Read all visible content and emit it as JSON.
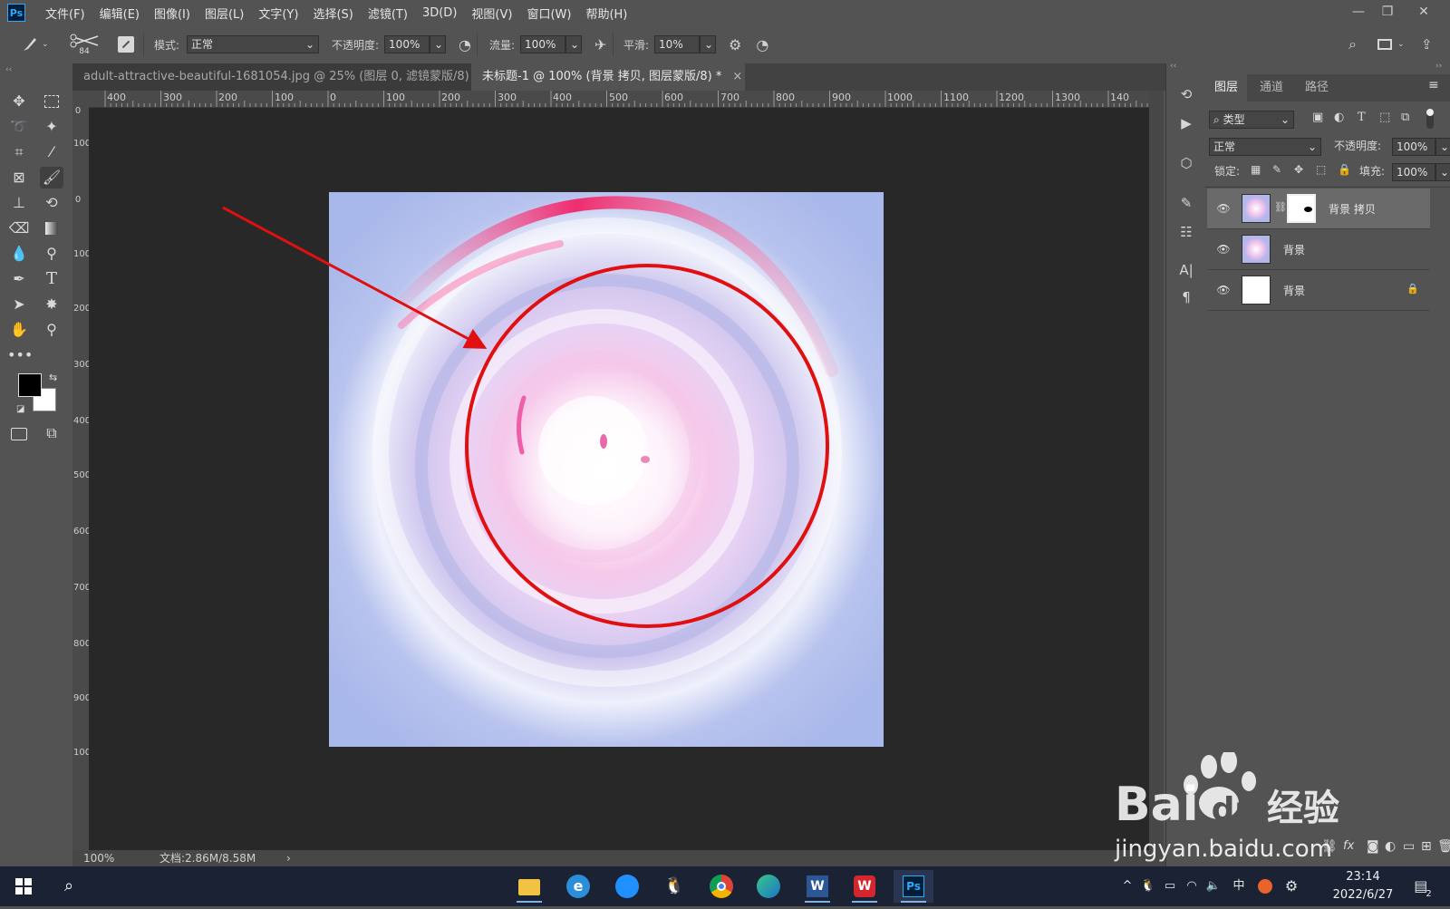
{
  "app": {
    "logo": "Ps"
  },
  "menu": [
    "文件(F)",
    "编辑(E)",
    "图像(I)",
    "图层(L)",
    "文字(Y)",
    "选择(S)",
    "滤镜(T)",
    "3D(D)",
    "视图(V)",
    "窗口(W)",
    "帮助(H)"
  ],
  "options": {
    "brush_size": "84",
    "mode_label": "模式:",
    "mode_value": "正常",
    "opacity_label": "不透明度:",
    "opacity_value": "100%",
    "flow_label": "流量:",
    "flow_value": "100%",
    "smoothing_label": "平滑:",
    "smoothing_value": "10%"
  },
  "tabs": [
    {
      "label": "adult-attractive-beautiful-1681054.jpg  @  25%  (图层 0, 滤镜蒙版/8) *",
      "close": "×"
    },
    {
      "label": "未标题-1 @ 100% (背景 拷贝, 图层蒙版/8) *",
      "close": "×"
    }
  ],
  "ruler_h": [
    "400",
    "300",
    "200",
    "100",
    "0",
    "100",
    "200",
    "300",
    "400",
    "500",
    "600",
    "700",
    "800",
    "900",
    "1000",
    "1100",
    "1200",
    "1300",
    "140"
  ],
  "ruler_v": [
    "0",
    "100",
    "0",
    "100",
    "200",
    "300",
    "400",
    "500",
    "600",
    "700",
    "800",
    "900",
    "100"
  ],
  "status": {
    "zoom": "100%",
    "doc": "文档:2.86M/8.58M",
    "arrow": "›"
  },
  "layers_panel": {
    "tabs": [
      "图层",
      "通道",
      "路径"
    ],
    "filter_label": "类型",
    "blend_mode": "正常",
    "opacity_label": "不透明度:",
    "opacity_value": "100%",
    "lock_label": "锁定:",
    "fill_label": "填充:",
    "fill_value": "100%",
    "layers": [
      {
        "name": "背景 拷贝",
        "selected": true,
        "has_mask": true,
        "locked": false
      },
      {
        "name": "背景",
        "selected": false,
        "has_mask": false,
        "locked": false
      },
      {
        "name": "背景",
        "selected": false,
        "has_mask": false,
        "locked": true
      }
    ]
  },
  "taskbar": {
    "time": "23:14",
    "date": "2022/6/27",
    "ime": "中",
    "notif_count": "2"
  },
  "watermark": {
    "brand": "Bai",
    "brand2": "du",
    "cn": "经验",
    "url": "jingyan.baidu.com"
  },
  "colors": {
    "accent": "#31a8ff",
    "annotation_red": "#e01010",
    "panel_bg": "#535353",
    "canvas_bg": "#282828"
  }
}
